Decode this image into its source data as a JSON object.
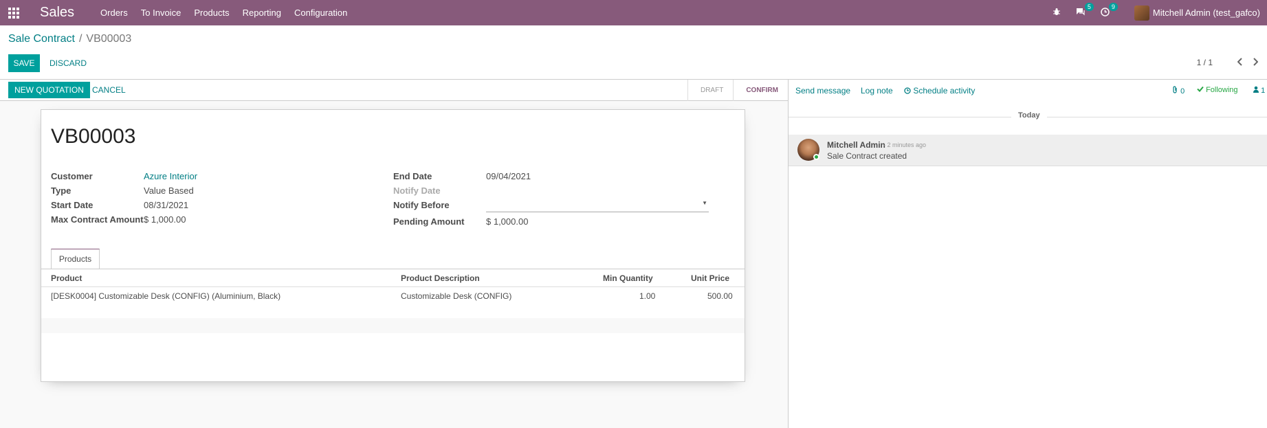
{
  "navbar": {
    "app_name": "Sales",
    "menu": [
      "Orders",
      "To Invoice",
      "Products",
      "Reporting",
      "Configuration"
    ],
    "messages_badge": "5",
    "activities_badge": "9",
    "user_name": "Mitchell Admin (test_gafco)",
    "icons": [
      "apps-grid-icon",
      "bug-icon",
      "chat-icon",
      "clock-icon"
    ]
  },
  "breadcrumb": {
    "parent": "Sale Contract",
    "separator": "/",
    "current": "VB00003"
  },
  "actions": {
    "save": "Save",
    "discard": "Discard"
  },
  "pager": {
    "value": "1 / 1",
    "prev": "‹",
    "next": "›"
  },
  "statusbar": {
    "new_quotation": "New Quotation",
    "cancel": "Cancel",
    "steps": [
      "Draft",
      "Confirm"
    ],
    "active_step": "Confirm"
  },
  "record": {
    "title": "VB00003",
    "left_fields": [
      {
        "label": "Customer",
        "value": "Azure Interior"
      },
      {
        "label": "Type",
        "value": "Value Based"
      },
      {
        "label": "Start Date",
        "value": "08/31/2021"
      },
      {
        "label": "Max Contract Amount",
        "value": "$ 1,000.00"
      }
    ],
    "right_fields": [
      {
        "label": "End Date",
        "value": "09/04/2021"
      },
      {
        "label": "Notify Date",
        "value": ""
      },
      {
        "label": "Notify Before",
        "value": ""
      },
      {
        "label": "Pending Amount",
        "value": "$ 1,000.00"
      }
    ]
  },
  "tabs": {
    "products": "Products"
  },
  "products_table": {
    "columns": [
      "Product",
      "Product Description",
      "Min Quantity",
      "Unit Price"
    ],
    "rows": [
      {
        "product": "[DESK0004] Customizable Desk (CONFIG) (Aluminium, Black)",
        "description": "Customizable Desk (CONFIG)",
        "min_qty": "1.00",
        "unit_price": "500.00"
      }
    ]
  },
  "chatter": {
    "send_message": "Send message",
    "log_note": "Log note",
    "schedule_activity": "Schedule activity",
    "attachments_count": "0",
    "following": "Following",
    "followers_count": "1",
    "date_separator": "Today",
    "messages": [
      {
        "author": "Mitchell Admin",
        "time": "- 2 minutes ago",
        "body": "Sale Contract created"
      }
    ]
  }
}
